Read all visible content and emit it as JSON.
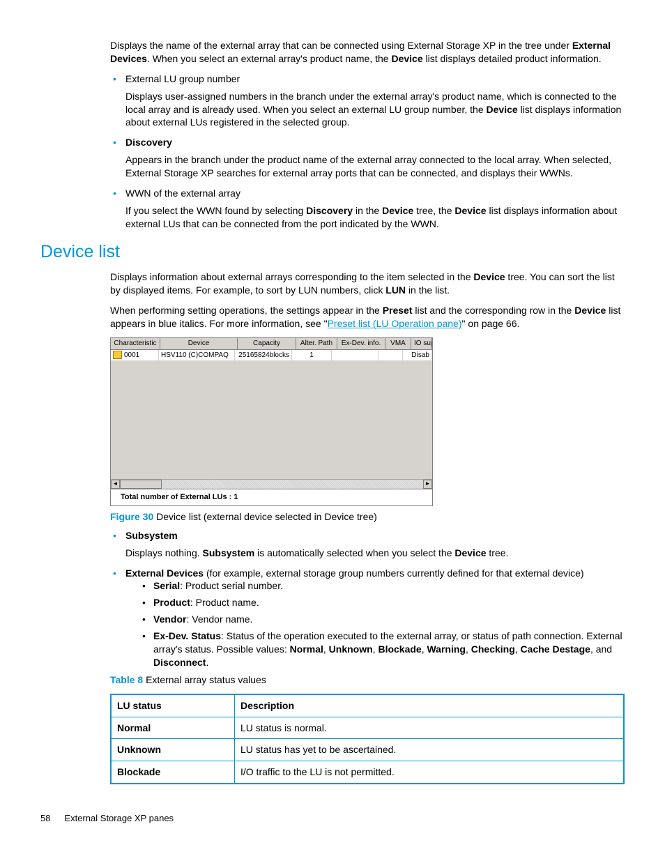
{
  "intro": {
    "p1_a": "Displays the name of the external array that can be connected using External Storage XP in the tree under ",
    "p1_b": "External Devices",
    "p1_c": ". When you select an external array's product name, the ",
    "p1_d": "Device",
    "p1_e": " list displays detailed product information."
  },
  "bullets1": {
    "b1_title": "External LU group number",
    "b1_body_a": "Displays user-assigned numbers in the branch under the external array's product name, which is connected to the local array and is already used. When you select an external LU group number, the ",
    "b1_body_b": "Device",
    "b1_body_c": " list displays information about external LUs registered in the selected group.",
    "b2_title": "Discovery",
    "b2_body": "Appears in the branch under the product name of the external array connected to the local array. When selected, External Storage XP searches for external array ports that can be connected, and displays their WWNs.",
    "b3_title": "WWN of the external array",
    "b3_body_a": "If you select the WWN found by selecting ",
    "b3_body_b": "Discovery",
    "b3_body_c": " in the ",
    "b3_body_d": "Device",
    "b3_body_e": " tree, the ",
    "b3_body_f": "Device",
    "b3_body_g": " list displays information about external LUs that can be connected from the port indicated by the WWN."
  },
  "heading": "Device list",
  "section": {
    "p1_a": "Displays information about external arrays corresponding to the item selected in the ",
    "p1_b": "Device",
    "p1_c": " tree. You can sort the list by displayed items. For example, to sort by LUN numbers, click ",
    "p1_d": "LUN",
    "p1_e": " in the list.",
    "p2_a": "When performing setting operations, the settings appear in the ",
    "p2_b": "Preset",
    "p2_c": " list and the corresponding row in the ",
    "p2_d": "Device",
    "p2_e": " list appears in blue italics. For more information, see \"",
    "p2_link": "Preset list (LU Operation pane)",
    "p2_f": "\" on page 66."
  },
  "screenshot": {
    "headers": [
      "Characteristic",
      "Device",
      "Capacity",
      "Alter. Path",
      "Ex-Dev. info.",
      "VMA",
      "IO suppre"
    ],
    "row": {
      "c1": "0001",
      "c2": "HSV110 (C)COMPAQ",
      "c3": "25165824blocks",
      "c4": "1",
      "c5": "",
      "c6": "",
      "c7": "Disab"
    },
    "footer": "Total number of External LUs : 1"
  },
  "figure": {
    "label": "Figure 30",
    "caption": "  Device list (external device selected in Device tree)"
  },
  "bullets2": {
    "b1_title": "Subsystem",
    "b1_body_a": "Displays nothing. ",
    "b1_body_b": "Subsystem",
    "b1_body_c": " is automatically selected when you select the ",
    "b1_body_d": "Device",
    "b1_body_e": " tree.",
    "b2_title": "External Devices",
    "b2_rest": " (for example, external storage group numbers currently defined for that external device)",
    "sub": {
      "s1_b": "Serial",
      "s1_r": ": Product serial number.",
      "s2_b": "Product",
      "s2_r": ": Product name.",
      "s3_b": "Vendor",
      "s3_r": ": Vendor name.",
      "s4_b": "Ex-Dev. Status",
      "s4_a": ": Status of the operation executed to the external array, or status of path connection. External array's status. Possible values: ",
      "s4_v1": "Normal",
      "s4_c1": ", ",
      "s4_v2": "Unknown",
      "s4_c2": ", ",
      "s4_v3": "Blockade",
      "s4_c3": ", ",
      "s4_v4": "Warning",
      "s4_c4": ", ",
      "s4_v5": "Checking",
      "s4_c5": ", ",
      "s4_v6": "Cache Destage",
      "s4_c6": ", and ",
      "s4_v7": "Disconnect",
      "s4_end": "."
    }
  },
  "table_caption": {
    "label": "Table 8",
    "caption": "   External array status values"
  },
  "table": {
    "h1": "LU status",
    "h2": "Description",
    "rows": [
      {
        "s": "Normal",
        "d": "LU status is normal."
      },
      {
        "s": "Unknown",
        "d": "LU status has yet to be ascertained."
      },
      {
        "s": "Blockade",
        "d": "I/O traffic to the LU is not permitted."
      }
    ]
  },
  "footer": {
    "page": "58",
    "title": "External Storage XP panes"
  }
}
